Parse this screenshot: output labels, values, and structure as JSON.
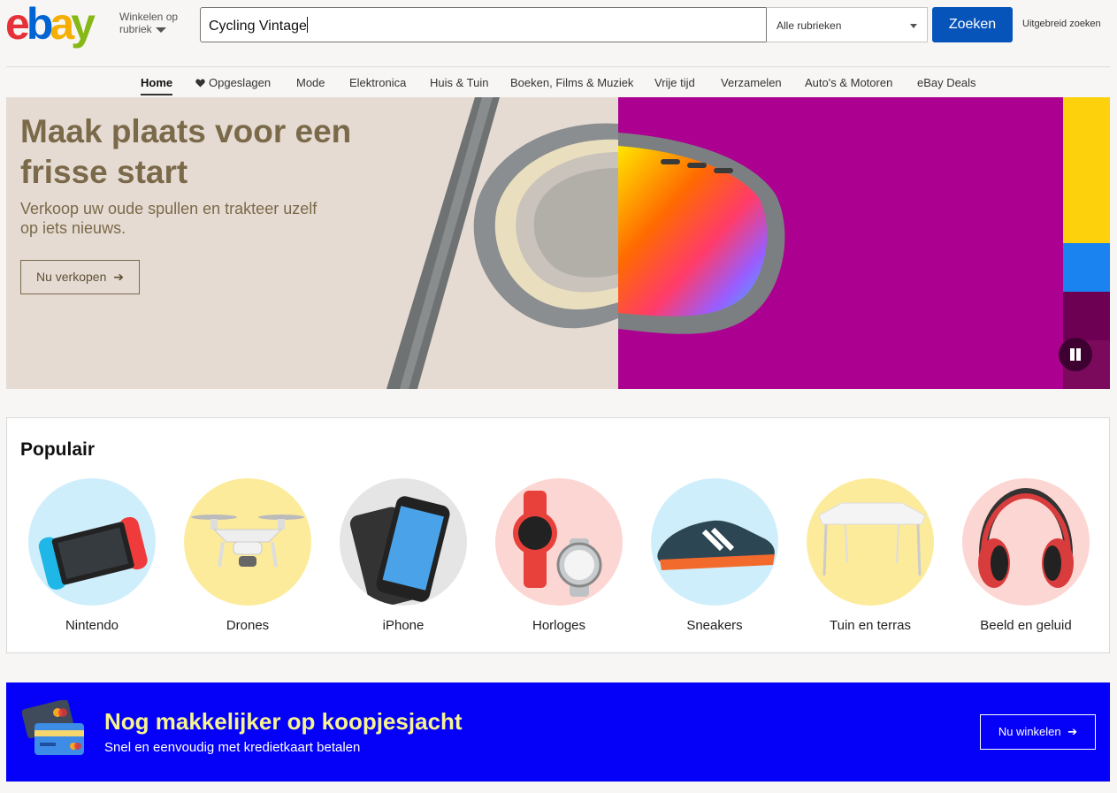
{
  "header": {
    "logo": {
      "e": "e",
      "b": "b",
      "a": "a",
      "y": "y"
    },
    "shop_by_category": "Winkelen op rubriek",
    "search_value": "Cycling Vintage",
    "category_select": "Alle rubrieken",
    "search_button": "Zoeken",
    "advanced_search": "Uitgebreid zoeken"
  },
  "nav": {
    "items": [
      {
        "label": "Home"
      },
      {
        "label": "Opgeslagen"
      },
      {
        "label": "Mode"
      },
      {
        "label": "Elektronica"
      },
      {
        "label": "Huis & Tuin"
      },
      {
        "label": "Boeken, Films & Muziek"
      },
      {
        "label": "Vrije tijd"
      },
      {
        "label": "Verzamelen"
      },
      {
        "label": "Auto's & Motoren"
      },
      {
        "label": "eBay Deals"
      }
    ]
  },
  "hero": {
    "title": "Maak plaats voor een frisse start",
    "subtitle": "Verkoop uw oude spullen en trakteer uzelf op iets nieuws.",
    "button": "Nu verkopen",
    "button_arrow": "➔"
  },
  "popular": {
    "title": "Populair",
    "items": [
      {
        "label": "Nintendo",
        "bg": "#cfeefb"
      },
      {
        "label": "Drones",
        "bg": "#fdeb9c"
      },
      {
        "label": "iPhone",
        "bg": "#e5e5e5"
      },
      {
        "label": "Horloges",
        "bg": "#fcd6d2"
      },
      {
        "label": "Sneakers",
        "bg": "#cfeefb"
      },
      {
        "label": "Tuin en terras",
        "bg": "#fdeb9c"
      },
      {
        "label": "Beeld en geluid",
        "bg": "#fcd6d2"
      }
    ]
  },
  "promo": {
    "title": "Nog makkelijker op koopjesjacht",
    "subtitle": "Snel en eenvoudig met kredietkaart betalen",
    "button": "Nu winkelen",
    "button_arrow": "➔"
  },
  "colors": {
    "search_button": "#0654ba",
    "hero_left": "#e5dbd3",
    "hero_right": "#ac0090",
    "promo_bg": "#0500f7",
    "promo_title": "#f6f48f"
  }
}
